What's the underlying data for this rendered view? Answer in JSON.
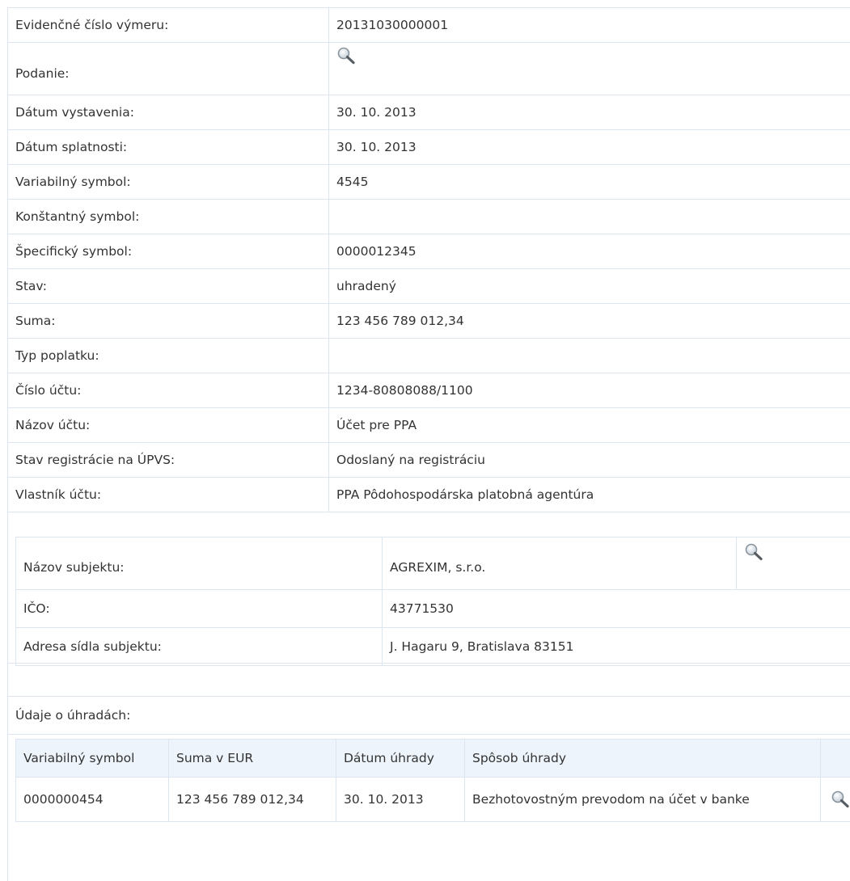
{
  "detail": {
    "rows": [
      {
        "label": "Evidenčné číslo výmeru:",
        "value": "20131030000001"
      },
      {
        "label": "Podanie:",
        "icon": "magnifier-icon"
      },
      {
        "label": "Dátum vystavenia:",
        "value": "30. 10. 2013"
      },
      {
        "label": "Dátum splatnosti:",
        "value": "30. 10. 2013"
      },
      {
        "label": "Variabilný symbol:",
        "value": "4545"
      },
      {
        "label": "Konštantný symbol:",
        "value": ""
      },
      {
        "label": "Špecifický symbol:",
        "value": "0000012345"
      },
      {
        "label": "Stav:",
        "value": "uhradený"
      },
      {
        "label": "Suma:",
        "value": "123 456 789 012,34"
      },
      {
        "label": "Typ poplatku:",
        "value": ""
      },
      {
        "label": "Číslo účtu:",
        "value": "1234-80808088/1100"
      },
      {
        "label": "Názov účtu:",
        "value": "Účet pre PPA"
      },
      {
        "label": "Stav registrácie na ÚPVS:",
        "value": "Odoslaný na registráciu"
      },
      {
        "label": "Vlastník účtu:",
        "value": "PPA Pôdohospodárska platobná agentúra"
      }
    ]
  },
  "subject": {
    "rows": [
      {
        "label": "Názov subjektu:",
        "value": "AGREXIM, s.r.o."
      },
      {
        "label": "IČO:",
        "value": "43771530"
      },
      {
        "label": "Adresa sídla subjektu:",
        "value": "J. Hagaru 9, Bratislava 83151"
      }
    ]
  },
  "payments": {
    "title": "Údaje o úhradách:",
    "headers": [
      "Variabilný symbol",
      "Suma v EUR",
      "Dátum úhrady",
      "Spôsob úhrady",
      ""
    ],
    "rows": [
      [
        "0000000454",
        "123 456 789 012,34",
        "30. 10. 2013",
        "Bezhotovostným prevodom na účet v banke"
      ]
    ]
  },
  "colors": {
    "border": "#dde6f0",
    "header_bg": "#eef4fb",
    "text": "#333333"
  }
}
